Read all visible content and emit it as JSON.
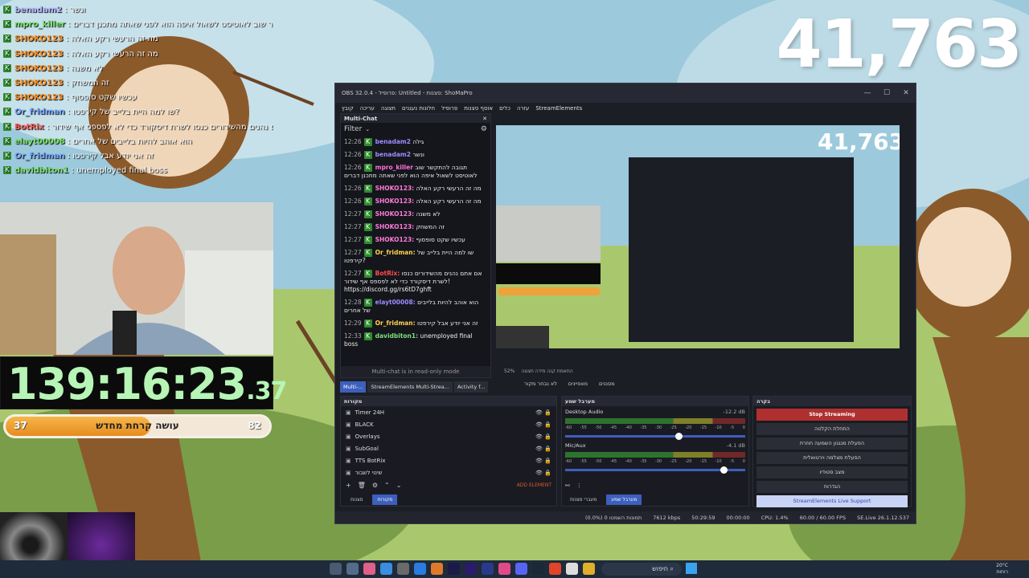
{
  "overlay": {
    "viewer_count": "41,763",
    "timer_main": "139:16:23",
    "timer_fraction": ".37",
    "progress": {
      "left": "37",
      "right": "82",
      "label": "עושה קרחת מחדש",
      "fill": 0.55
    }
  },
  "chat": [
    {
      "user": "benadam2",
      "color": "#b6b6ff",
      "msg": ": ונשר"
    },
    {
      "user": "mpro_killer",
      "color": "#79e36b",
      "msg": ": תגובה להתקשר שוב לאוטיסט לשאול איפה הוא לפני שאתה מתכנן דברים"
    },
    {
      "user": "SHOKO123",
      "color": "#ff8c1a",
      "msg": ": מה זה הרעשי רקע האלה"
    },
    {
      "user": "SHOKO123",
      "color": "#ff8c1a",
      "msg": ": מה זה הרעשי רקע האלה"
    },
    {
      "user": "SHOKO123",
      "color": "#ff8c1a",
      "msg": ": לא משנה"
    },
    {
      "user": "SHOKO123",
      "color": "#ff8c1a",
      "msg": ": זה המשחק"
    },
    {
      "user": "SHOKO123",
      "color": "#ff8c1a",
      "msg": ": עכשיו שקט סופסוף"
    },
    {
      "user": "Or_fridman",
      "color": "#79a8ff",
      "msg": ": שו למה היית בלייב של קירפטו?"
    },
    {
      "user": "BotRix",
      "color": "#ff5a5a",
      "msg": ": אם אתם נהנים מהשידורים כנסו לשרת דיסקורד כדי לא לפספס אף שידור! https://discord.gg/rs6tD7ghft"
    },
    {
      "user": "elayt00008",
      "color": "#79e36b",
      "msg": ": הוא אוהב להיות בלייבים של אחרים"
    },
    {
      "user": "Or_fridman",
      "color": "#79a8ff",
      "msg": ": זה אני יודע אבל קירפטו"
    },
    {
      "user": "davidbiton1",
      "color": "#79e36b",
      "msg": ": unemployed final boss"
    }
  ],
  "obs": {
    "title": "OBS 32.0.4 - פרופיל: Untitled - סצנות: ShoMaPro",
    "menu": [
      "קובץ",
      "עריכה",
      "תצוגה",
      "חלונות נעגנים",
      "פרופיל",
      "אוסף סצנות",
      "כלים",
      "עזרה",
      "StreamElements"
    ],
    "multichat": {
      "title": "Multi-Chat",
      "filter": "Filter",
      "footer": "Multi-chat is in read-only mode",
      "lines": [
        {
          "time": "12:26",
          "user": "benadam2",
          "color": "#9a8cff",
          "msg": "גילה"
        },
        {
          "time": "12:26",
          "user": "benadam2",
          "color": "#9a8cff",
          "msg": "ונשר"
        },
        {
          "time": "12:26",
          "user": "mpro_killer",
          "color": "#ff6fd8",
          "msg": "תגובה להתקשר שוב לאוטיסט לשאול איפה הוא לפני שאתה מתכנן דברים"
        },
        {
          "time": "12:26",
          "user": "SHOKO123:",
          "color": "#ff7ad9",
          "msg": "מה זה הרעשי רקע האלה"
        },
        {
          "time": "12:26",
          "user": "SHOKO123:",
          "color": "#ff7ad9",
          "msg": "מה זה הרעשי רקע האלה"
        },
        {
          "time": "12:27",
          "user": "SHOKO123:",
          "color": "#ff7ad9",
          "msg": "לא משנה"
        },
        {
          "time": "12:27",
          "user": "SHOKO123:",
          "color": "#ff7ad9",
          "msg": "זה המשחק"
        },
        {
          "time": "12:27",
          "user": "SHOKO123:",
          "color": "#ff7ad9",
          "msg": "עכשיו שקט סופסוף"
        },
        {
          "time": "12:27",
          "user": "Or_fridman:",
          "color": "#ffd24a",
          "msg": "שו למה היית בלייב של קירפטו?"
        },
        {
          "time": "12:27",
          "user": "BotRix:",
          "color": "#ff4a4a",
          "msg": "אם אתם נהנים מהשידורים כנסו לשרת דיסקורד כדי לא לפספס אף שידור! https://discord.gg/rs6tD7ghft"
        },
        {
          "time": "12:28",
          "user": "elayt00008:",
          "color": "#9a8cff",
          "msg": "הוא אוהב להיות בלייבים של אחרים"
        },
        {
          "time": "12:29",
          "user": "Or_fridman:",
          "color": "#ffd24a",
          "msg": "זה אני יודע אבל קירפטו"
        },
        {
          "time": "12:33",
          "user": "davidbiton1:",
          "color": "#7be07b",
          "msg": "unemployed final boss"
        }
      ]
    },
    "dock_tabs": [
      "Multi-...",
      "StreamElements Multi-Strea...",
      "Activity f..."
    ],
    "zoom": "52%",
    "zoom_label": "התאמת קנה מידה תצוגה",
    "controls": [
      "לא נבחר מקור",
      "מאפיינים",
      "מסננים"
    ],
    "sources": {
      "title": "מקורות",
      "items": [
        "Timer 24H",
        "BLACK",
        "Overlays",
        "SubGoal",
        "TTS BotRix",
        "שינוי לשבור"
      ],
      "add_element": "ADD ELEMENT",
      "tab_scenes": "סצנות",
      "tab_sources": "מקורות"
    },
    "mixer": {
      "title": "מערבל שמע",
      "channels": [
        {
          "name": "Desktop Audio",
          "db": "-12.2 dB",
          "level": 0.63
        },
        {
          "name": "Mic/Aux",
          "db": "-4.1 dB",
          "level": 0.88
        }
      ],
      "ticks": [
        "-60",
        "-55",
        "-50",
        "-45",
        "-40",
        "-35",
        "-30",
        "-25",
        "-20",
        "-15",
        "-10",
        "-5",
        "0"
      ],
      "tab_mixer": "מערבל שמע",
      "tab_transitions": "מעברי סצנות"
    },
    "controls_dock": {
      "title": "בקרה",
      "buttons": [
        "Stop Streaming",
        "התחלת הקלטה",
        "הפעלת מנגנון השמעה חוזרת",
        "הפעלת מצלמה וירטואלית",
        "מצב סטודיו",
        "הגדרות",
        "StreamElements Live Support"
      ]
    },
    "status": {
      "dropped": "(0.0%) 0 תמונות השמטו",
      "bitrate": "7612 kbps",
      "live_time": "50:29:59",
      "rec_time": "00:00:00",
      "cpu": "CPU: 1.4%",
      "fps": "60.00 / 60.00 FPS",
      "se": "SE.Live 26.1.12.537"
    }
  },
  "taskbar": {
    "search": "חיפוש",
    "weather": "20°C",
    "weather_desc": "רוחות"
  }
}
